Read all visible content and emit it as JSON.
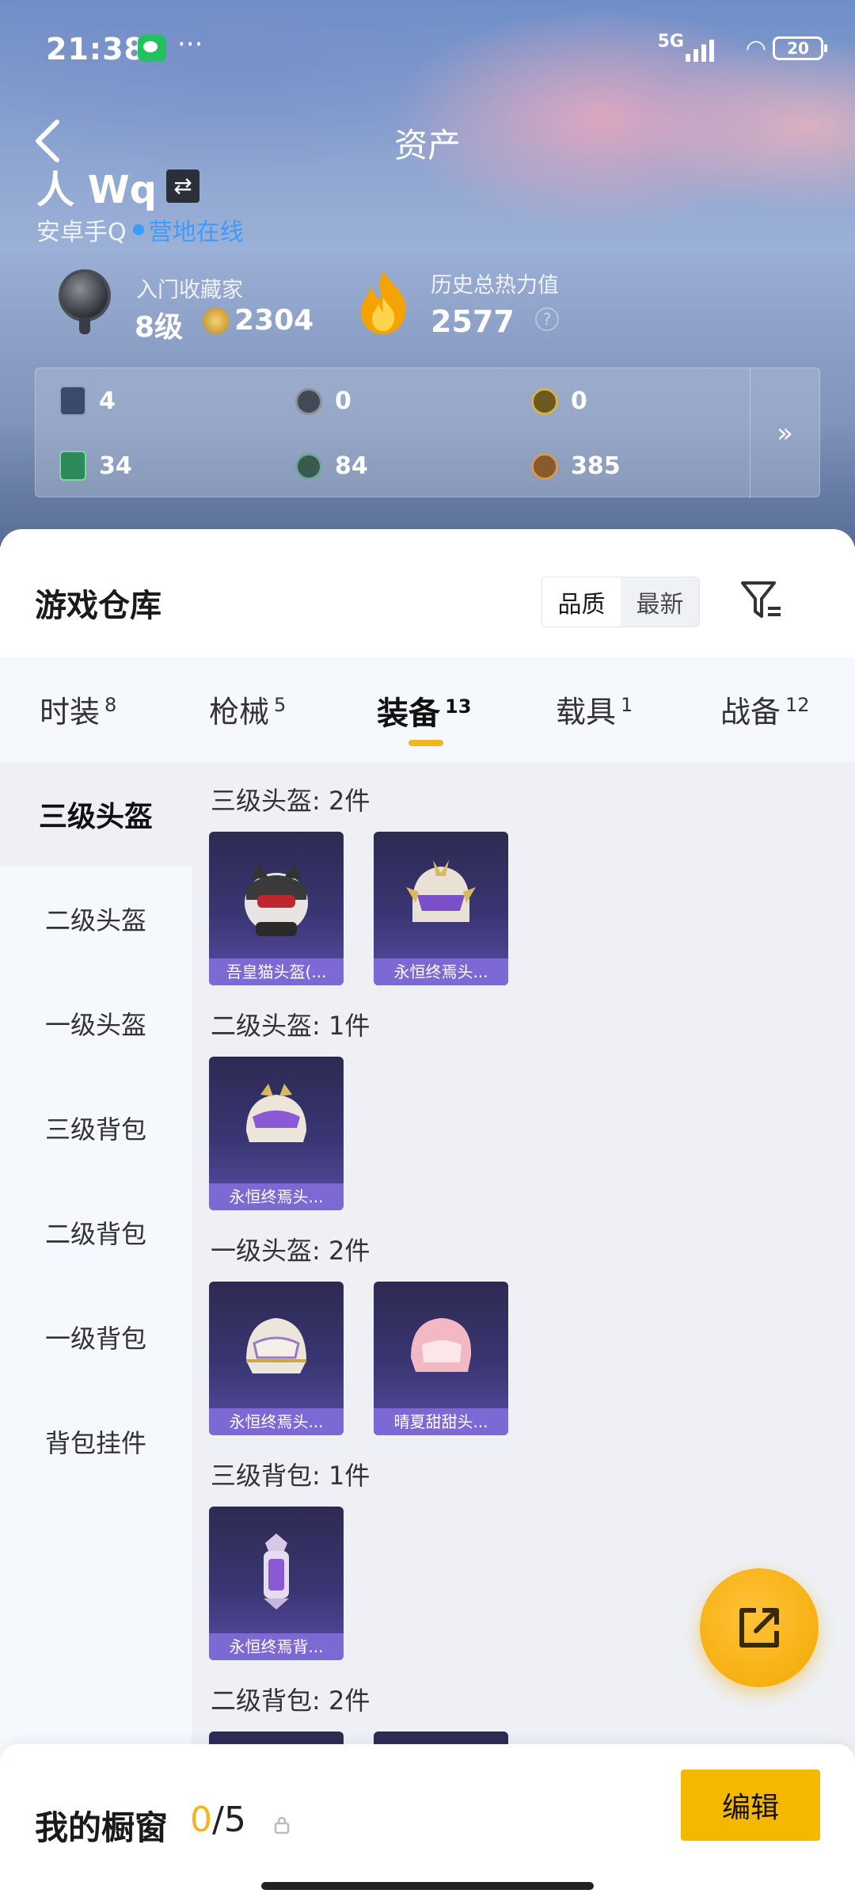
{
  "status_bar": {
    "time": "21:38",
    "network": "5G",
    "battery": "20"
  },
  "header": {
    "title": "资产",
    "username": "人 Wq",
    "platform": "安卓手Q",
    "online_status": "营地在线"
  },
  "stats": {
    "collector_title": "入门收藏家",
    "collector_level": "8级",
    "collector_points": "2304",
    "heat_title": "历史总热力值",
    "heat_value": "2577",
    "help": "?"
  },
  "resources": [
    {
      "value": "4",
      "icon": "card-icon",
      "color": "#3a4a6a"
    },
    {
      "value": "0",
      "icon": "silver-coin-icon",
      "color": "#444a55"
    },
    {
      "value": "0",
      "icon": "gold-coin-icon",
      "color": "#6a5a20"
    },
    {
      "value": "34",
      "icon": "green-card-icon",
      "color": "#2e8a5a"
    },
    {
      "value": "84",
      "icon": "green-coin-icon",
      "color": "#3a5a50"
    },
    {
      "value": "385",
      "icon": "bronze-coin-icon",
      "color": "#8a5a2a"
    }
  ],
  "warehouse": {
    "title": "游戏仓库",
    "sort_quality": "品质",
    "sort_latest": "最新"
  },
  "tabs": [
    {
      "label": "时装",
      "count": "8"
    },
    {
      "label": "枪械",
      "count": "5"
    },
    {
      "label": "装备",
      "count": "13"
    },
    {
      "label": "载具",
      "count": "1"
    },
    {
      "label": "战备",
      "count": "12"
    }
  ],
  "sidebar": [
    "三级头盔",
    "二级头盔",
    "一级头盔",
    "三级背包",
    "二级背包",
    "一级背包",
    "背包挂件"
  ],
  "sections": [
    {
      "title": "三级头盔: 2件",
      "items": [
        "吾皇猫头盔(...",
        "永恒终焉头..."
      ]
    },
    {
      "title": "二级头盔: 1件",
      "items": [
        "永恒终焉头..."
      ]
    },
    {
      "title": "一级头盔: 2件",
      "items": [
        "永恒终焉头...",
        "晴夏甜甜头..."
      ]
    },
    {
      "title": "三级背包: 1件",
      "items": [
        "永恒终焉背..."
      ]
    },
    {
      "title": "二级背包: 2件",
      "items": []
    }
  ],
  "showcase": {
    "label": "我的橱窗",
    "used": "0",
    "total": "/5",
    "edit": "编辑"
  },
  "colors": {
    "accent": "#f5b800",
    "online": "#3c9bff",
    "card_purple": "#7c69d4"
  }
}
